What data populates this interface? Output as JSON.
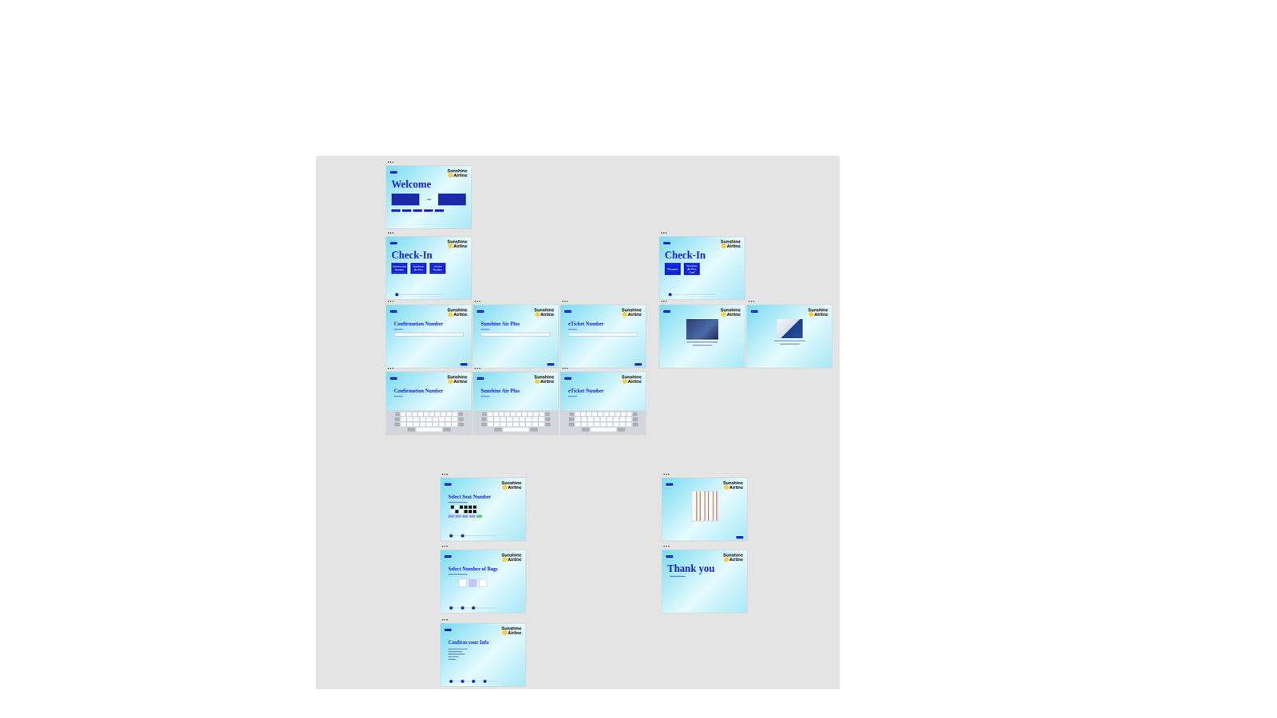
{
  "canvas": {
    "handle": "•••"
  },
  "logo": [
    "Sunshine",
    "Airline"
  ],
  "frames": [
    {
      "kind": "welcome",
      "title": "Welcome"
    },
    {
      "kind": "menu",
      "title": "Check-In",
      "options": [
        "Confirmation Number",
        "Sunshine Air Plus",
        "eTicket Number"
      ],
      "steps": [
        true,
        false,
        false,
        false,
        false
      ]
    },
    {
      "kind": "input",
      "title": "Confirmation Number"
    },
    {
      "kind": "input",
      "title": "Sunshine Air Plus"
    },
    {
      "kind": "input",
      "title": "eTicket Number"
    },
    {
      "kind": "keyboard",
      "title": "Confirmation Number"
    },
    {
      "kind": "keyboard",
      "title": "Sunshine Air Plus"
    },
    {
      "kind": "keyboard",
      "title": "eTicket Number"
    },
    {
      "kind": "menu",
      "title": "Check-In",
      "options": [
        "Passport",
        "Sunshine Air Plus Card"
      ],
      "steps": [
        true,
        false,
        false,
        false,
        false
      ]
    },
    {
      "kind": "passport",
      "title": ""
    },
    {
      "kind": "card",
      "title": ""
    },
    {
      "kind": "seat",
      "title": "Select Seat Number",
      "steps": [
        true,
        true,
        false,
        false,
        false
      ],
      "seats": [
        true,
        false,
        true,
        true,
        true,
        true,
        false,
        true,
        false,
        true,
        true,
        true
      ],
      "seatButtons": [
        {
          "color": "#9a9af0"
        },
        {
          "color": "#9a9af0"
        },
        {
          "color": "#9a9af0"
        },
        {
          "color": "#9a9af0"
        },
        {
          "color": "#3ddc54"
        }
      ]
    },
    {
      "kind": "bags",
      "title": "Select Number of Bags",
      "steps": [
        true,
        true,
        true,
        false,
        false
      ],
      "bags": [
        false,
        true,
        false
      ]
    },
    {
      "kind": "confirm",
      "title": "Confirm your Info",
      "steps": [
        true,
        true,
        true,
        true,
        false
      ]
    },
    {
      "kind": "foods",
      "title": ""
    },
    {
      "kind": "thanks",
      "title": "Thank you"
    }
  ]
}
